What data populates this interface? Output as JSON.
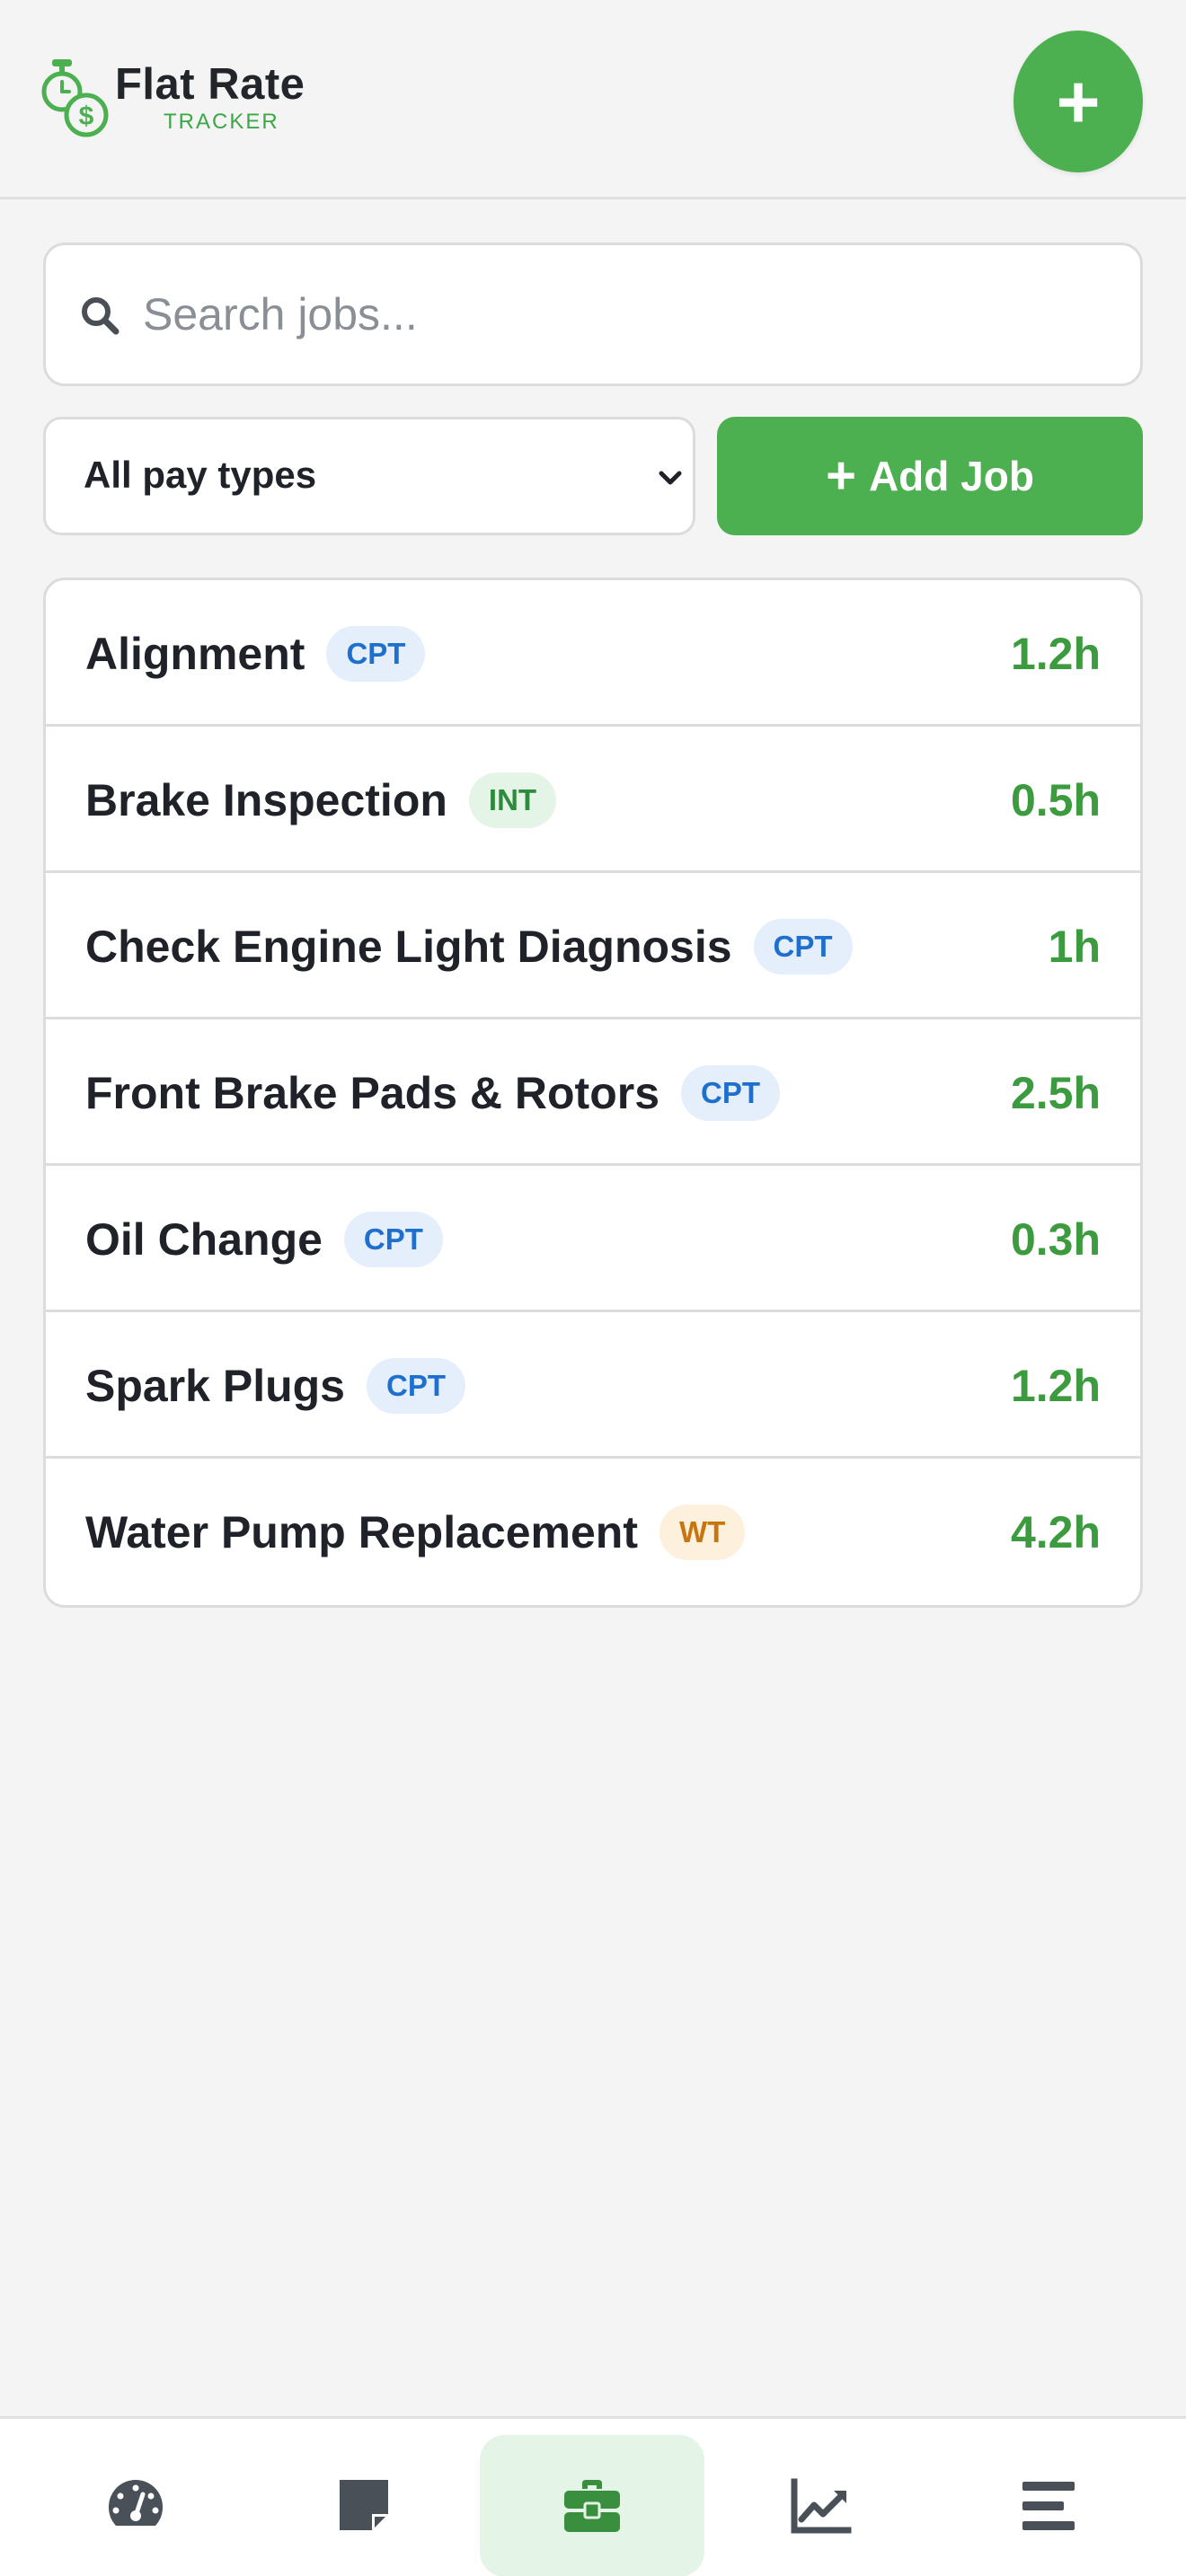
{
  "app": {
    "name": "Flat Rate",
    "tagline": "TRACKER",
    "brand_color": "#4cb050"
  },
  "header": {
    "fab_label": "+"
  },
  "search": {
    "placeholder": "Search jobs...",
    "value": ""
  },
  "filters": {
    "pay_type_selected": "All pay types",
    "add_job_plus": "+",
    "add_job_label": "Add Job"
  },
  "jobs": [
    {
      "name": "Alignment",
      "pay_type": "CPT",
      "hours": "1.2h"
    },
    {
      "name": "Brake Inspection",
      "pay_type": "INT",
      "hours": "0.5h"
    },
    {
      "name": "Check Engine Light Diagnosis",
      "pay_type": "CPT",
      "hours": "1h"
    },
    {
      "name": "Front Brake Pads & Rotors",
      "pay_type": "CPT",
      "hours": "2.5h"
    },
    {
      "name": "Oil Change",
      "pay_type": "CPT",
      "hours": "0.3h"
    },
    {
      "name": "Spark Plugs",
      "pay_type": "CPT",
      "hours": "1.2h"
    },
    {
      "name": "Water Pump Replacement",
      "pay_type": "WT",
      "hours": "4.2h"
    }
  ],
  "pay_type_colors": {
    "CPT": "#1f6fcf",
    "INT": "#2e8b3b",
    "WT": "#c8740f"
  },
  "bottom_nav": [
    {
      "icon": "dashboard-gauge-icon",
      "active": false
    },
    {
      "icon": "note-icon",
      "active": false
    },
    {
      "icon": "toolbox-icon",
      "active": true
    },
    {
      "icon": "chart-line-icon",
      "active": false
    },
    {
      "icon": "menu-icon",
      "active": false
    }
  ]
}
